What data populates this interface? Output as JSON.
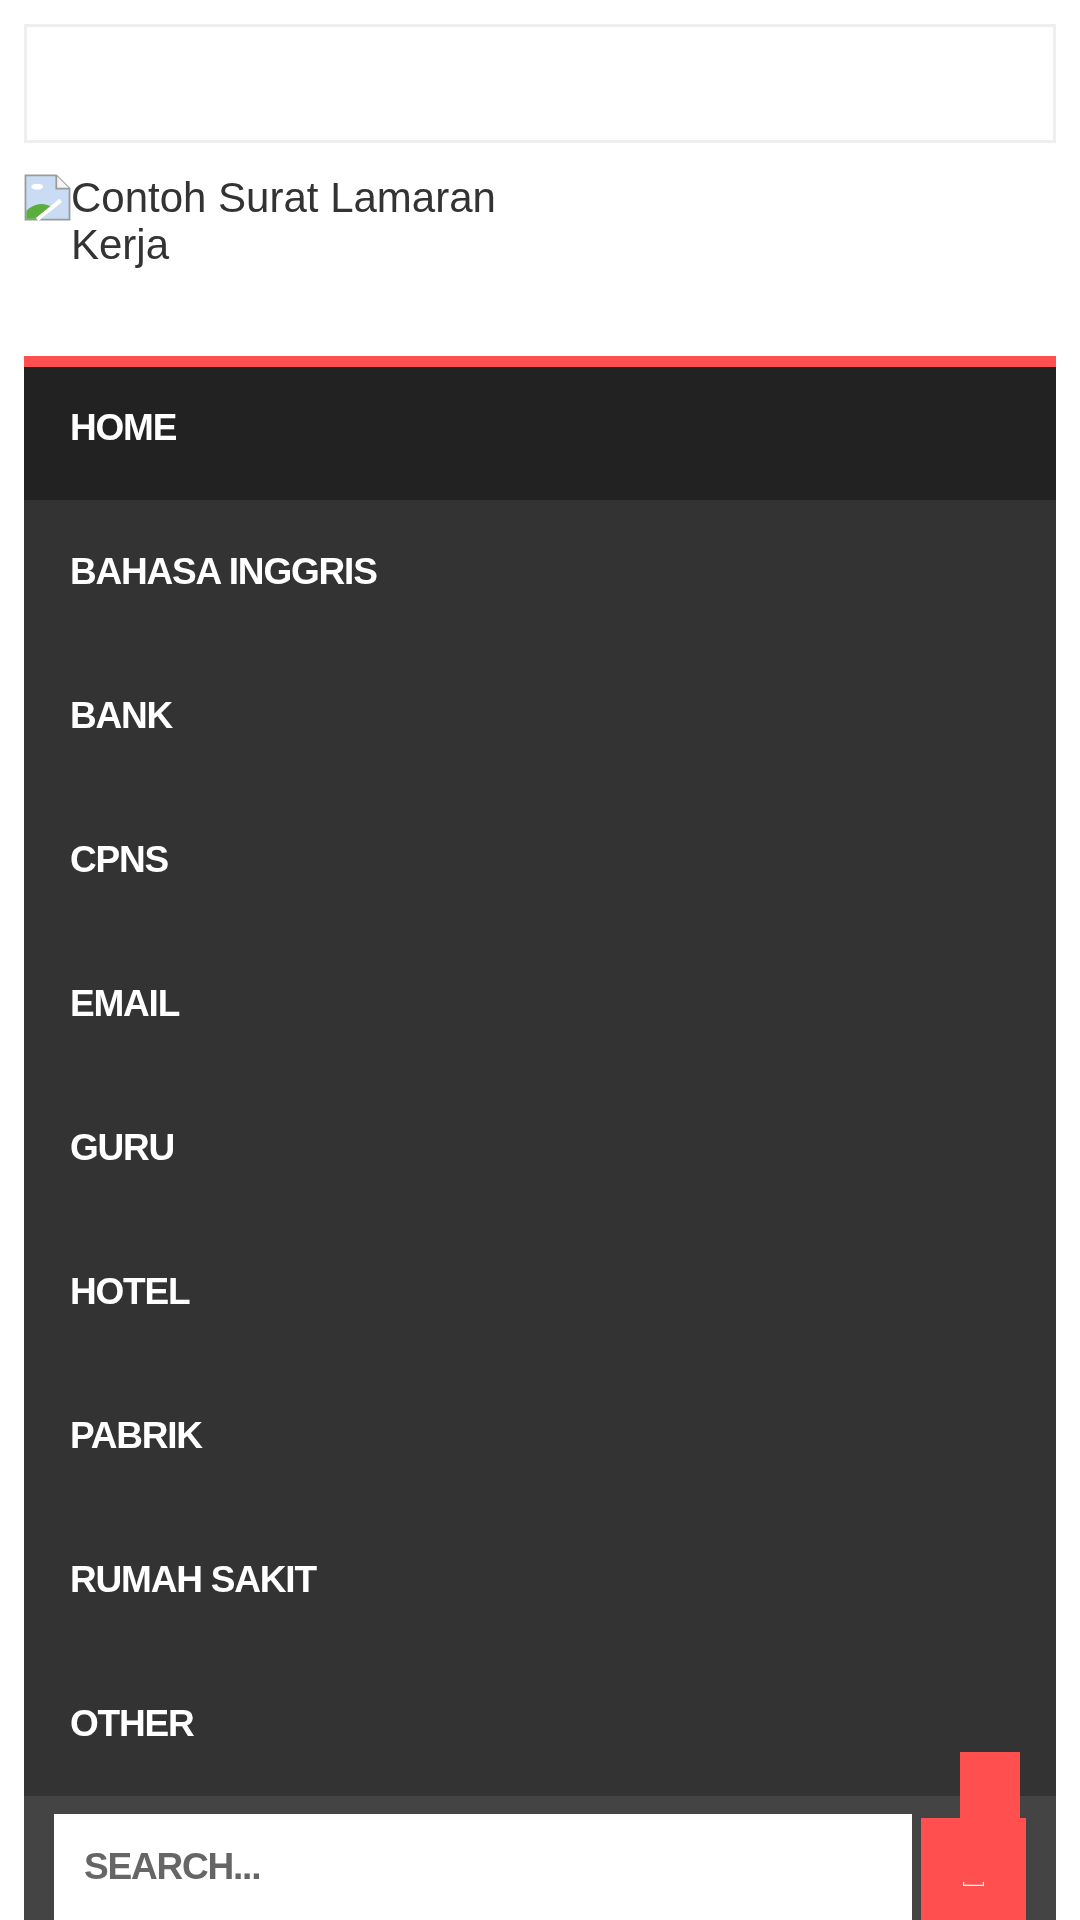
{
  "header": {
    "logo_alt": "Contoh Surat Lamaran Kerja"
  },
  "menu": {
    "items": [
      {
        "label": "HOME",
        "selected": true
      },
      {
        "label": "BAHASA INGGRIS",
        "selected": false
      },
      {
        "label": "BANK",
        "selected": false
      },
      {
        "label": "CPNS",
        "selected": false
      },
      {
        "label": "EMAIL",
        "selected": false
      },
      {
        "label": "GURU",
        "selected": false
      },
      {
        "label": "HOTEL",
        "selected": false
      },
      {
        "label": "PABRIK",
        "selected": false
      },
      {
        "label": "RUMAH SAKIT",
        "selected": false
      },
      {
        "label": "OTHER",
        "selected": false
      }
    ]
  },
  "search": {
    "placeholder": "SEARCH..."
  }
}
